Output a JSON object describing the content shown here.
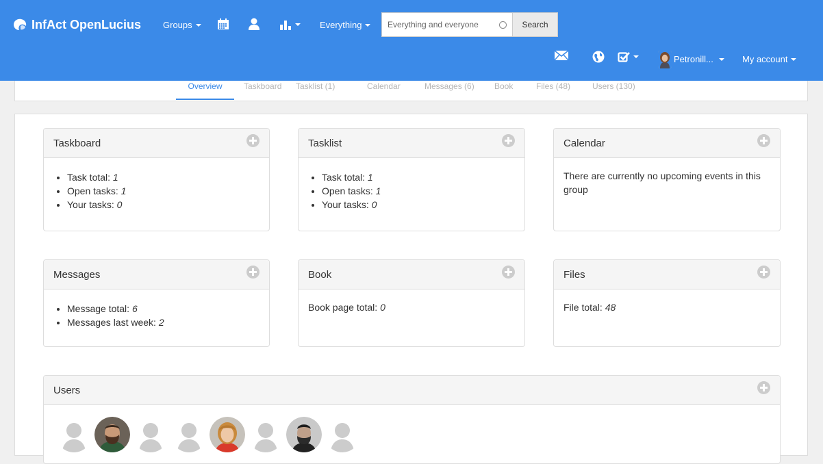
{
  "nav": {
    "brand": "InfAct OpenLucius",
    "groups": "Groups",
    "everything": "Everything",
    "search_placeholder": "Everything and everyone",
    "search_button": "Search",
    "user": "Petronill...",
    "my_account": "My account",
    "colors": {
      "navbar": "#3b8ae8"
    }
  },
  "tabs": [
    {
      "label": "Overview",
      "active": true
    },
    {
      "label": "Taskboard"
    },
    {
      "label": "Tasklist (1)"
    },
    {
      "label": "Calendar"
    },
    {
      "label": "Messages (6)"
    },
    {
      "label": "Book"
    },
    {
      "label": "Files (48)"
    },
    {
      "label": "Users (130)"
    }
  ],
  "cards": {
    "taskboard": {
      "title": "Taskboard",
      "items": [
        {
          "label": "Task total: ",
          "value": "1"
        },
        {
          "label": "Open tasks: ",
          "value": "1"
        },
        {
          "label": "Your tasks: ",
          "value": "0"
        }
      ]
    },
    "tasklist": {
      "title": "Tasklist",
      "items": [
        {
          "label": "Task total: ",
          "value": "1"
        },
        {
          "label": "Open tasks: ",
          "value": "1"
        },
        {
          "label": "Your tasks: ",
          "value": "0"
        }
      ]
    },
    "calendar": {
      "title": "Calendar",
      "text": "There are currently no upcoming events in this group"
    },
    "messages": {
      "title": "Messages",
      "items": [
        {
          "label": "Message total: ",
          "value": "6"
        },
        {
          "label": "Messages last week: ",
          "value": "2"
        }
      ]
    },
    "book": {
      "title": "Book",
      "label": "Book page total: ",
      "value": "0"
    },
    "files": {
      "title": "Files",
      "label": "File total: ",
      "value": "48"
    },
    "users": {
      "title": "Users",
      "avatars": [
        "placeholder",
        "photo-man-beard",
        "placeholder",
        "placeholder",
        "photo-woman-red",
        "placeholder",
        "photo-man-dark",
        "placeholder"
      ]
    }
  }
}
